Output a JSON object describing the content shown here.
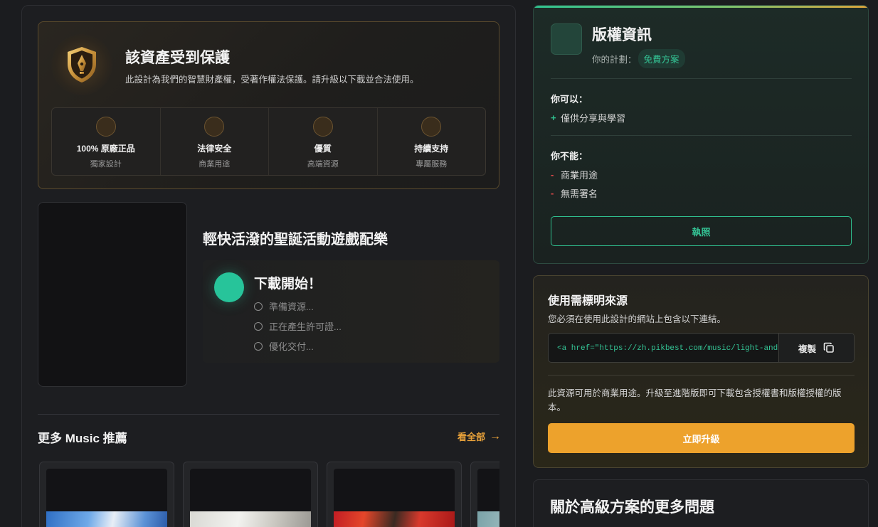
{
  "protection": {
    "title": "該資產受到保護",
    "description": "此設計為我們的智慧財產權，受著作權法保護。請升級以下載並合法使用。",
    "features": [
      {
        "title": "100% 原廠正品",
        "subtitle": "獨家設計"
      },
      {
        "title": "法律安全",
        "subtitle": "商業用途"
      },
      {
        "title": "優質",
        "subtitle": "高端資源"
      },
      {
        "title": "持續支持",
        "subtitle": "專屬服務"
      }
    ]
  },
  "track": {
    "title": "輕快活潑的聖誕活動遊戲配樂"
  },
  "download": {
    "title": "下載開始！",
    "steps": [
      "準備資源...",
      "正在產生許可證...",
      "優化交付..."
    ]
  },
  "more": {
    "title": "更多 Music 推薦",
    "see_all": "看全部"
  },
  "license": {
    "title": "版權資訊",
    "plan_label": "你的計劃：",
    "plan_name": "免費方案",
    "can_label": "你可以：",
    "can_items": [
      "僅供分享與學習"
    ],
    "cannot_label": "你不能：",
    "cannot_items": [
      "商業用途",
      "無需署名"
    ],
    "button": "執照"
  },
  "attribution": {
    "title": "使用需標明來源",
    "description": "您必須在使用此設計的網站上包含以下連結。",
    "code": "<a href=\"https://zh.pikbest.com/music/light-and-lively-christmas",
    "copy_label": "複製",
    "note": "此資源可用於商業用途。升級至進階版即可下載包含授權書和版權授權的版本。",
    "upgrade_button": "立即升級"
  },
  "faq": {
    "title": "關於高級方案的更多問題"
  },
  "colors": {
    "accent_green": "#2fbf8e",
    "accent_orange": "#eda22c",
    "danger_red": "#e04a4a"
  }
}
